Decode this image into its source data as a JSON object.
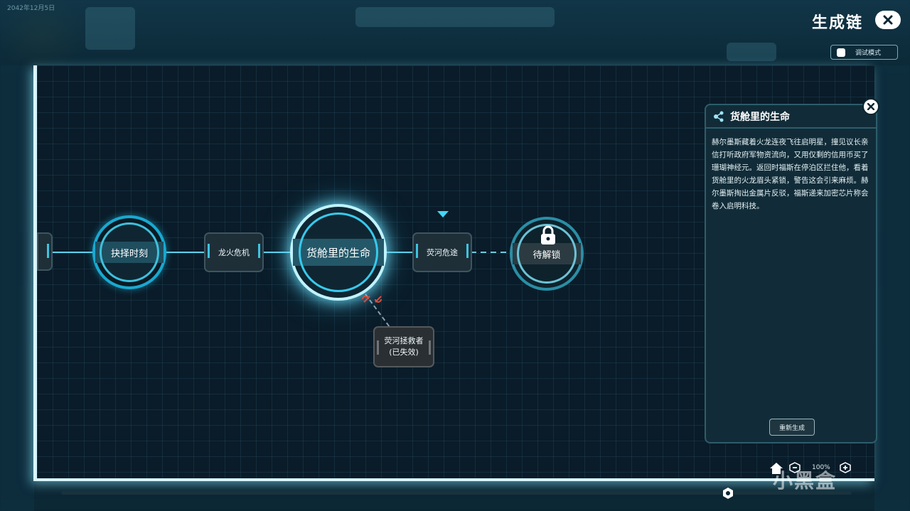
{
  "background": {
    "date": "2042年12月5日"
  },
  "header": {
    "title": "生成链",
    "debug_mode_label": "调试模式"
  },
  "chain": {
    "edge_node": "",
    "nodes": [
      {
        "label": "抉择时刻"
      },
      {
        "label": "龙火危机"
      },
      {
        "label": "货舱里的生命"
      },
      {
        "label": "荧河危途"
      },
      {
        "label": "待解锁"
      }
    ],
    "branch": {
      "line1": "荧河拯救者",
      "line2": "(已失效)"
    }
  },
  "panel": {
    "title": "货舱里的生命",
    "description": "赫尔墨斯藏着火龙连夜飞往启明星，撞见议长亲信打听政府军物资流向，又用仅剩的信用币买了珊瑚神经元。返回时福斯在停泊区拦住他，看着货舱里的火龙眉头紧锁，警告这会引来麻烦。赫尔墨斯掏出金属片反驳，福斯递来加密芯片称会卷入启明科技。",
    "regenerate_label": "重新生成"
  },
  "controls": {
    "zoom": "100%"
  },
  "watermark": "小黑盒",
  "colors": {
    "accent": "#5fd0ea",
    "glow": "#bff3ff",
    "panel_bg": "#112c38",
    "warning": "#e04a3a"
  }
}
